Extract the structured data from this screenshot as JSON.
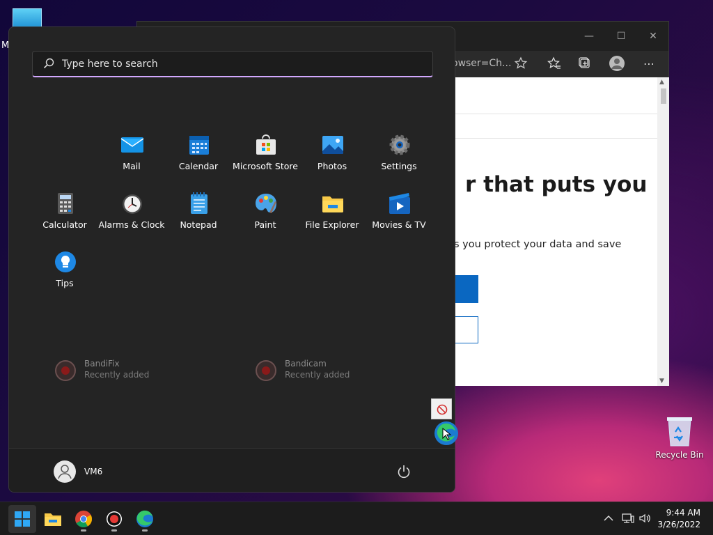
{
  "desktop": {
    "partial_icon_letter": "M",
    "recycle_bin_label": "Recycle Bin"
  },
  "browser": {
    "address_fragment": "owser=Ch...",
    "page_heading": "r that puts you",
    "page_subtext": "s you protect your data and save",
    "window_controls": {
      "minimize": "—",
      "maximize": "☐",
      "close": "✕"
    },
    "toolbar_more": "⋯"
  },
  "start_menu": {
    "search_placeholder": "Type here to search",
    "pinned_apps": [
      {
        "label": "Mail",
        "icon": "mail-icon"
      },
      {
        "label": "Calendar",
        "icon": "calendar-icon"
      },
      {
        "label": "Microsoft Store",
        "icon": "store-icon"
      },
      {
        "label": "Photos",
        "icon": "photos-icon"
      },
      {
        "label": "Settings",
        "icon": "gear-icon"
      },
      {
        "label": "Calculator",
        "icon": "calculator-icon"
      },
      {
        "label": "Alarms & Clock",
        "icon": "clock-icon"
      },
      {
        "label": "Notepad",
        "icon": "notepad-icon"
      },
      {
        "label": "Paint",
        "icon": "paint-icon"
      },
      {
        "label": "File Explorer",
        "icon": "folder-icon"
      },
      {
        "label": "Movies & TV",
        "icon": "movies-icon"
      },
      {
        "label": "Tips",
        "icon": "lightbulb-icon"
      }
    ],
    "recommended": [
      {
        "name": "BandiFix",
        "sub": "Recently added",
        "icon": "bandifix-icon"
      },
      {
        "name": "Bandicam",
        "sub": "Recently added",
        "icon": "bandicam-icon"
      }
    ],
    "user_name": "VM6"
  },
  "taskbar": {
    "apps": [
      "start-icon",
      "file-explorer-icon",
      "chrome-icon",
      "bandicam-icon",
      "edge-icon"
    ],
    "time": "9:44 AM",
    "date": "3/26/2022"
  },
  "colors": {
    "start_bg": "#242424",
    "search_accent": "#d2a8ff",
    "primary_blue": "#0a67c1"
  }
}
